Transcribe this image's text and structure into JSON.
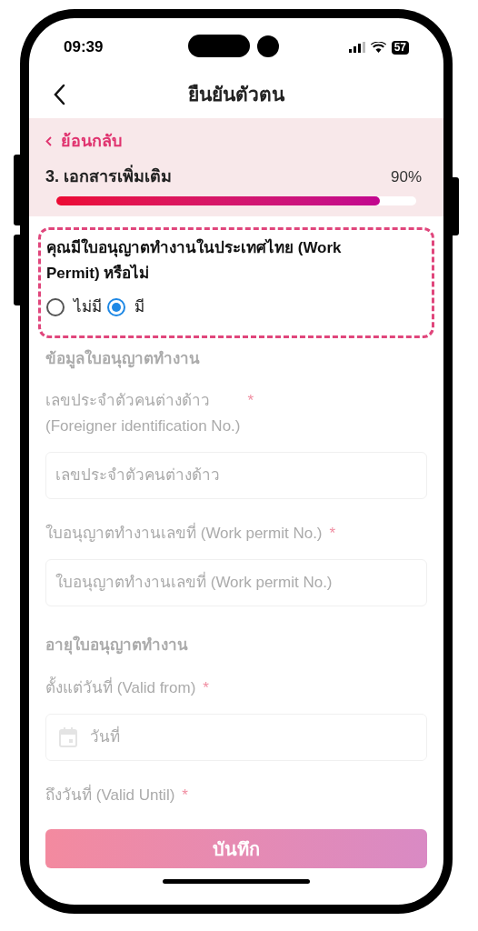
{
  "status_bar": {
    "time": "09:39",
    "battery": "57"
  },
  "header": {
    "title": "ยืนยันตัวตน"
  },
  "progress": {
    "back_label": "ย้อนกลับ",
    "step": "3. เอกสารเพิ่มเติม",
    "percent": "90%",
    "level": 0.9
  },
  "question": {
    "text": "คุณมีใบอนุญาตทำงานในประเทศไทย (Work Permit) หรือไม่",
    "options": [
      {
        "label": "ไม่มี",
        "selected": false
      },
      {
        "label": "มี",
        "selected": true
      }
    ]
  },
  "form": {
    "disabled": true,
    "items": [
      {
        "kind": "heading",
        "text": "ข้อมูลใบอนุญาตทำงาน"
      },
      {
        "kind": "label",
        "text": "เลขประจำตัวคนต่างด้าว\n(Foreigner identification No.)",
        "mark": "*"
      },
      {
        "kind": "input",
        "placeholder": "เลขประจำตัวคนต่างด้าว"
      },
      {
        "kind": "label",
        "text": "ใบอนุญาตทำงานเลขที่ (Work permit No.)",
        "mark": "*"
      },
      {
        "kind": "input",
        "placeholder": "ใบอนุญาตทำงานเลขที่ (Work permit No.)"
      },
      {
        "kind": "heading",
        "text": "อายุใบอนุญาตทำงาน"
      },
      {
        "kind": "label",
        "text": "ตั้งแต่วันที่ (Valid from)",
        "mark": "*"
      },
      {
        "kind": "date",
        "placeholder": "วันที่"
      },
      {
        "kind": "label",
        "text": "ถึงวันที่ (Valid Until)",
        "mark": "*"
      }
    ]
  },
  "save_button": {
    "label": "บันทึก",
    "disabled": true
  }
}
